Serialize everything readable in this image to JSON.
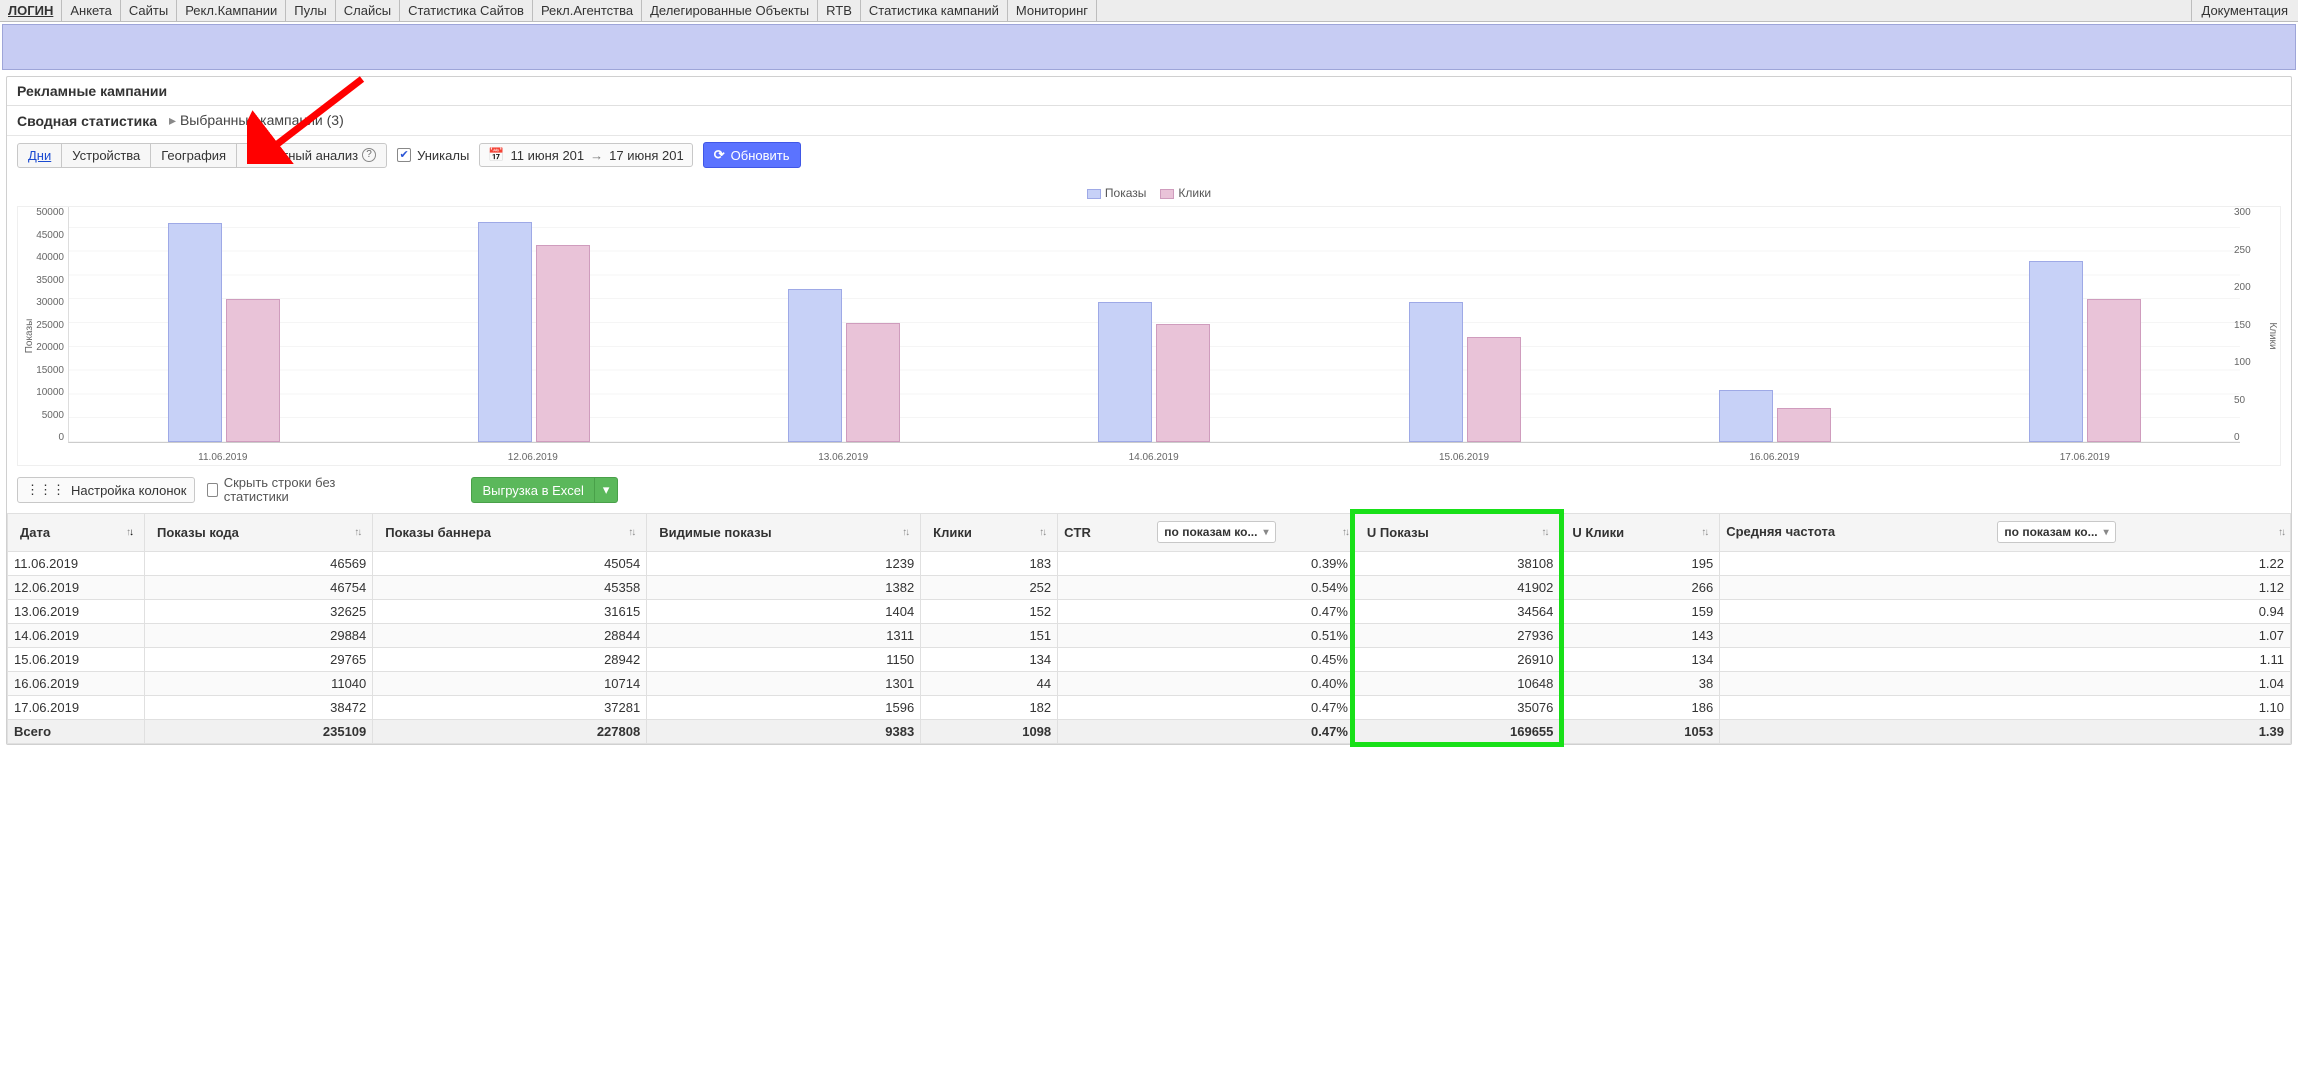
{
  "nav": {
    "login": "ЛОГИН",
    "items": [
      "Анкета",
      "Сайты",
      "Рекл.Кампании",
      "Пулы",
      "Слайсы",
      "Статистика Сайтов",
      "Рекл.Агентства",
      "Делегированные Объекты",
      "RTB",
      "Статистика кампаний",
      "Мониторинг"
    ],
    "doc": "Документация"
  },
  "panel": {
    "title": "Рекламные кампании",
    "sub_title": "Сводная статистика",
    "selected_campaigns": "Выбранные кампании (3)"
  },
  "tabs": {
    "days": "Дни",
    "devices": "Устройства",
    "geo": "География",
    "freq": "Частотный анализ"
  },
  "check_uniques": {
    "label": "Уникалы",
    "checked": true
  },
  "date": {
    "from": "11 июня 201",
    "to": "17 июня 201"
  },
  "refresh": "Обновить",
  "legend": {
    "shows": "Показы",
    "clicks": "Клики"
  },
  "axis": {
    "left_label": "Показы",
    "right_label": "Клики"
  },
  "col_settings": "Настройка колонок",
  "hide_rows": "Скрыть строки без статистики",
  "excel": "Выгрузка в Excel",
  "headers": {
    "date": "Дата",
    "code_shows": "Показы кода",
    "banner_shows": "Показы баннера",
    "visible_shows": "Видимые показы",
    "clicks": "Клики",
    "ctr": "CTR",
    "ctr_select": "по показам ко...",
    "u_shows": "U Показы",
    "u_clicks": "U Клики",
    "avg_freq": "Средняя частота",
    "avg_freq_select": "по показам ко..."
  },
  "rows": [
    {
      "date": "11.06.2019",
      "code": 46569,
      "banner": 45054,
      "vis": 1239,
      "clicks": 183,
      "ctr": "0.39%",
      "ushows": 38108,
      "uclicks": 195,
      "freq": "1.22"
    },
    {
      "date": "12.06.2019",
      "code": 46754,
      "banner": 45358,
      "vis": 1382,
      "clicks": 252,
      "ctr": "0.54%",
      "ushows": 41902,
      "uclicks": 266,
      "freq": "1.12"
    },
    {
      "date": "13.06.2019",
      "code": 32625,
      "banner": 31615,
      "vis": 1404,
      "clicks": 152,
      "ctr": "0.47%",
      "ushows": 34564,
      "uclicks": 159,
      "freq": "0.94"
    },
    {
      "date": "14.06.2019",
      "code": 29884,
      "banner": 28844,
      "vis": 1311,
      "clicks": 151,
      "ctr": "0.51%",
      "ushows": 27936,
      "uclicks": 143,
      "freq": "1.07"
    },
    {
      "date": "15.06.2019",
      "code": 29765,
      "banner": 28942,
      "vis": 1150,
      "clicks": 134,
      "ctr": "0.45%",
      "ushows": 26910,
      "uclicks": 134,
      "freq": "1.11"
    },
    {
      "date": "16.06.2019",
      "code": 11040,
      "banner": 10714,
      "vis": 1301,
      "clicks": 44,
      "ctr": "0.40%",
      "ushows": 10648,
      "uclicks": 38,
      "freq": "1.04"
    },
    {
      "date": "17.06.2019",
      "code": 38472,
      "banner": 37281,
      "vis": 1596,
      "clicks": 182,
      "ctr": "0.47%",
      "ushows": 35076,
      "uclicks": 186,
      "freq": "1.10"
    }
  ],
  "totals": {
    "label": "Всего",
    "code": 235109,
    "banner": 227808,
    "vis": 9383,
    "clicks": 1098,
    "ctr": "0.47%",
    "ushows": 169655,
    "uclicks": 1053,
    "freq": "1.39"
  },
  "chart_data": {
    "type": "bar",
    "categories": [
      "11.06.2019",
      "12.06.2019",
      "13.06.2019",
      "14.06.2019",
      "15.06.2019",
      "16.06.2019",
      "17.06.2019"
    ],
    "series": [
      {
        "name": "Показы",
        "axis": "left",
        "values": [
          46569,
          46754,
          32625,
          29884,
          29765,
          11040,
          38472
        ]
      },
      {
        "name": "Клики",
        "axis": "right",
        "values": [
          183,
          252,
          152,
          151,
          134,
          44,
          182
        ]
      }
    ],
    "left_axis": {
      "label": "Показы",
      "min": 0,
      "max": 50000,
      "step": 5000
    },
    "right_axis": {
      "label": "Клики",
      "min": 0,
      "max": 300,
      "step": 50
    }
  }
}
